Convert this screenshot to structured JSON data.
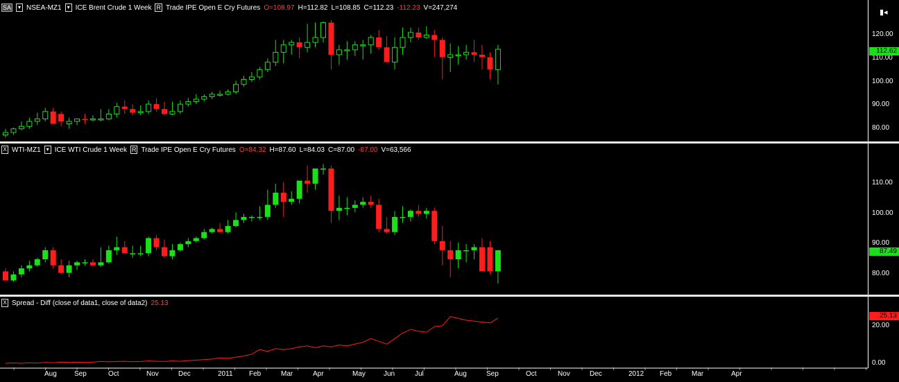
{
  "panels": [
    {
      "symbol_box": "SA",
      "symbol": "NSEA-MZ1",
      "desc": "ICE Brent Crude  1 Week",
      "rbox": "R",
      "info": "Trade  IPE  Open E Cry  Futures",
      "o_text": "O=108.97",
      "h_text": "H=112.82",
      "l_text": "L=108.85",
      "c_text": "C=112.23",
      "chg_text": "-112.23",
      "v_text": "V=247,274",
      "last_price": "112.62",
      "ticks": [
        "120.00",
        "110.00",
        "100.00",
        "90.00",
        "80.00"
      ]
    },
    {
      "symbol_box": "X",
      "symbol": "WTI-MZ1",
      "desc": "ICE WTI Crude  1 Week",
      "rbox": "R",
      "info": "Trade  IPE  Open E Cry  Futures",
      "o_text": "O=84.32",
      "h_text": "H=87.60",
      "l_text": "L=84.03",
      "c_text": "C=87.00",
      "chg_text": "-87.00",
      "v_text": "V=63,566",
      "last_price": "87.49",
      "ticks": [
        "110.00",
        "100.00",
        "90.00",
        "80.00"
      ]
    },
    {
      "symbol_box": "X",
      "title": "Spread - Diff  (close of data1,  close of data2)",
      "value_text": "25.13",
      "last_price": "25.13",
      "ticks": [
        "20.00",
        "0.00"
      ]
    }
  ],
  "x_axis_labels": [
    "Aug",
    "Sep",
    "Oct",
    "Nov",
    "Dec",
    "2011",
    "Feb",
    "Mar",
    "Apr",
    "May",
    "Jun",
    "Jul",
    "Aug",
    "Sep",
    "Oct",
    "Nov",
    "Dec",
    "2012",
    "Feb",
    "Mar",
    "Apr"
  ],
  "colors": {
    "up": "#19e019",
    "down": "#ff1c1c",
    "spread": "#ff1c1c",
    "background": "#000000"
  },
  "chart_data": [
    {
      "type": "candlestick",
      "name": "NSEA-MZ1",
      "ylim": [
        76,
        126
      ],
      "x": [
        "Jul",
        "Jul",
        "Aug",
        "Aug",
        "Aug",
        "Aug",
        "Aug",
        "Sep",
        "Sep",
        "Sep",
        "Sep",
        "Oct",
        "Oct",
        "Oct",
        "Oct",
        "Oct",
        "Nov",
        "Nov",
        "Nov",
        "Nov",
        "Dec",
        "Dec",
        "Dec",
        "Dec",
        "2011",
        "2011",
        "2011",
        "2011",
        "Feb",
        "Feb",
        "Feb",
        "Feb",
        "Mar",
        "Mar",
        "Mar",
        "Mar",
        "Mar",
        "Apr",
        "Apr",
        "Apr",
        "Apr",
        "May",
        "May",
        "May",
        "May",
        "Jun",
        "Jun",
        "Jun",
        "Jun",
        "Jun",
        "Jul",
        "Jul",
        "Jul",
        "Jul",
        "Aug",
        "Aug",
        "Aug",
        "Aug",
        "Sep",
        "Sep",
        "Sep",
        "Sep",
        "Oct"
      ],
      "open": [
        77.5,
        78.5,
        80.0,
        81.0,
        83.0,
        84.0,
        87.0,
        86.0,
        82.0,
        83.0,
        84.0,
        83.8,
        84.0,
        84.0,
        86.0,
        89.0,
        88.0,
        86.5,
        87.0,
        90.0,
        88.0,
        86.0,
        87.0,
        90.0,
        91.0,
        92.0,
        93.0,
        94.0,
        94.0,
        95.0,
        98.0,
        100.0,
        101.0,
        104.0,
        107.0,
        111.0,
        114.0,
        115.0,
        113.0,
        115.0,
        117.0,
        123.0,
        110.0,
        112.0,
        112.0,
        114.0,
        114.0,
        117.0,
        113.0,
        107.0,
        113.0,
        117.0,
        119.0,
        117.0,
        118.0,
        116.0,
        109.0,
        110.0,
        110.0,
        111.0,
        110.0,
        109.0,
        104.0
      ],
      "high": [
        80.0,
        80.5,
        83.0,
        84.5,
        86.5,
        88.5,
        88.5,
        87.0,
        84.5,
        84.0,
        86.0,
        85.5,
        88.0,
        88.0,
        90.5,
        91.5,
        90.0,
        89.5,
        91.5,
        92.5,
        91.0,
        91.0,
        91.5,
        92.5,
        94.0,
        94.0,
        95.0,
        95.5,
        96.0,
        99.5,
        101.5,
        103.0,
        105.0,
        108.5,
        116.0,
        116.0,
        116.0,
        117.0,
        122.5,
        123.0,
        123.5,
        124.0,
        114.0,
        115.5,
        115.5,
        116.0,
        118.0,
        120.0,
        117.5,
        117.0,
        121.0,
        121.0,
        121.0,
        121.5,
        120.0,
        117.0,
        114.5,
        113.5,
        114.0,
        116.0,
        114.0,
        111.0,
        114.0
      ],
      "low": [
        76.5,
        77.5,
        79.5,
        80.0,
        81.5,
        83.0,
        82.5,
        81.0,
        80.0,
        81.5,
        82.0,
        83.0,
        83.0,
        83.5,
        84.5,
        86.0,
        85.5,
        85.5,
        86.0,
        87.0,
        85.5,
        85.5,
        86.0,
        89.0,
        90.0,
        91.0,
        92.0,
        93.0,
        93.5,
        94.0,
        97.0,
        99.0,
        100.0,
        103.0,
        105.5,
        106.5,
        110.0,
        108.5,
        111.0,
        113.0,
        115.0,
        104.0,
        106.0,
        108.0,
        109.5,
        108.0,
        110.5,
        112.0,
        107.0,
        104.0,
        110.0,
        115.0,
        116.0,
        116.5,
        109.0,
        100.0,
        103.0,
        106.0,
        108.0,
        107.0,
        104.0,
        100.0,
        98.0
      ],
      "close": [
        78.5,
        80.0,
        81.0,
        83.0,
        84.0,
        87.0,
        82.0,
        83.0,
        83.0,
        84.0,
        83.8,
        84.0,
        84.0,
        86.0,
        89.0,
        88.0,
        86.5,
        87.0,
        90.0,
        88.0,
        86.0,
        87.0,
        90.0,
        91.0,
        92.0,
        93.0,
        94.0,
        94.0,
        95.0,
        98.0,
        100.0,
        101.0,
        104.0,
        107.0,
        111.0,
        114.0,
        115.0,
        113.0,
        115.0,
        117.0,
        123.0,
        110.0,
        112.0,
        112.0,
        114.0,
        114.0,
        117.0,
        113.0,
        107.0,
        113.0,
        117.0,
        119.0,
        117.0,
        118.0,
        116.0,
        109.0,
        110.0,
        110.0,
        111.0,
        110.0,
        109.0,
        104.0,
        112.23
      ]
    },
    {
      "type": "candlestick",
      "name": "WTI-MZ1",
      "ylim": [
        73,
        117
      ],
      "x": [
        "Jul",
        "Jul",
        "Aug",
        "Aug",
        "Aug",
        "Aug",
        "Aug",
        "Sep",
        "Sep",
        "Sep",
        "Sep",
        "Oct",
        "Oct",
        "Oct",
        "Oct",
        "Oct",
        "Nov",
        "Nov",
        "Nov",
        "Nov",
        "Dec",
        "Dec",
        "Dec",
        "Dec",
        "2011",
        "2011",
        "2011",
        "2011",
        "Feb",
        "Feb",
        "Feb",
        "Feb",
        "Mar",
        "Mar",
        "Mar",
        "Mar",
        "Mar",
        "Apr",
        "Apr",
        "Apr",
        "Apr",
        "May",
        "May",
        "May",
        "May",
        "Jun",
        "Jun",
        "Jun",
        "Jun",
        "Jun",
        "Jul",
        "Jul",
        "Jul",
        "Jul",
        "Aug",
        "Aug",
        "Aug",
        "Aug",
        "Sep",
        "Sep",
        "Sep",
        "Sep",
        "Oct"
      ],
      "open": [
        80.0,
        77.0,
        79.0,
        81.0,
        82.0,
        84.0,
        87.0,
        82.0,
        79.5,
        82.0,
        83.0,
        83.0,
        82.0,
        83.0,
        87.0,
        88.0,
        86.0,
        86.0,
        86.0,
        91.0,
        88.0,
        85.0,
        87.0,
        89.0,
        90.0,
        91.0,
        93.0,
        94.0,
        93.0,
        95.0,
        97.0,
        98.0,
        98.0,
        98.0,
        102.0,
        106.0,
        103.0,
        104.0,
        110.0,
        109.0,
        114.0,
        114.0,
        100.0,
        101.0,
        101.0,
        102.0,
        103.0,
        102.0,
        94.0,
        93.0,
        98.0,
        98.0,
        100.0,
        99.0,
        100.0,
        90.0,
        87.0,
        84.0,
        87.0,
        87.0,
        88.0,
        88.0,
        80.0
      ],
      "high": [
        81.0,
        80.0,
        82.0,
        83.5,
        84.5,
        88.0,
        88.0,
        84.0,
        83.5,
        83.5,
        84.0,
        84.0,
        88.0,
        88.5,
        91.5,
        90.0,
        88.5,
        88.5,
        91.5,
        92.0,
        90.5,
        89.0,
        89.5,
        91.0,
        91.5,
        94.0,
        94.5,
        96.0,
        97.0,
        99.5,
        99.0,
        98.5,
        101.5,
        107.0,
        109.0,
        109.5,
        106.5,
        108.0,
        115.0,
        114.0,
        115.5,
        115.0,
        105.0,
        104.5,
        103.5,
        104.5,
        105.0,
        104.0,
        98.0,
        100.0,
        101.5,
        100.5,
        102.0,
        101.0,
        101.0,
        95.0,
        90.0,
        89.5,
        89.0,
        89.0,
        91.0,
        90.0,
        84.0
      ],
      "low": [
        77.0,
        76.5,
        78.0,
        80.0,
        81.5,
        83.0,
        81.0,
        79.0,
        78.0,
        80.5,
        82.0,
        81.5,
        81.5,
        82.5,
        85.5,
        86.0,
        84.5,
        85.0,
        85.0,
        87.0,
        84.5,
        84.0,
        86.5,
        88.0,
        89.5,
        90.5,
        92.5,
        93.0,
        92.5,
        94.5,
        96.0,
        96.5,
        97.0,
        97.0,
        101.0,
        98.0,
        102.0,
        102.5,
        106.0,
        107.0,
        112.0,
        96.0,
        97.0,
        98.5,
        99.5,
        101.0,
        101.0,
        93.0,
        92.5,
        92.0,
        96.0,
        96.5,
        98.0,
        97.5,
        89.0,
        82.0,
        78.0,
        81.0,
        83.0,
        84.0,
        80.5,
        79.0,
        76.0
      ],
      "close": [
        77.0,
        79.0,
        81.0,
        82.0,
        84.0,
        87.0,
        82.0,
        79.5,
        82.0,
        83.0,
        83.0,
        82.0,
        83.0,
        87.0,
        88.0,
        86.0,
        86.0,
        86.0,
        91.0,
        88.0,
        85.0,
        87.0,
        89.0,
        90.0,
        91.0,
        93.0,
        94.0,
        93.0,
        95.0,
        97.0,
        98.0,
        98.0,
        98.0,
        102.0,
        106.0,
        103.0,
        104.0,
        110.0,
        109.0,
        114.0,
        114.0,
        100.0,
        101.0,
        101.0,
        102.0,
        103.0,
        102.0,
        94.0,
        93.0,
        98.0,
        98.0,
        100.0,
        99.0,
        100.0,
        90.0,
        87.0,
        84.0,
        87.0,
        87.0,
        88.0,
        80.0,
        80.0,
        87.0
      ]
    },
    {
      "type": "line",
      "name": "Spread - Diff",
      "ylim": [
        -1,
        30
      ],
      "x": [
        "Jul",
        "Jul",
        "Aug",
        "Aug",
        "Aug",
        "Aug",
        "Aug",
        "Sep",
        "Sep",
        "Sep",
        "Sep",
        "Oct",
        "Oct",
        "Oct",
        "Oct",
        "Oct",
        "Nov",
        "Nov",
        "Nov",
        "Nov",
        "Dec",
        "Dec",
        "Dec",
        "Dec",
        "2011",
        "2011",
        "2011",
        "2011",
        "Feb",
        "Feb",
        "Feb",
        "Feb",
        "Mar",
        "Mar",
        "Mar",
        "Mar",
        "Mar",
        "Apr",
        "Apr",
        "Apr",
        "Apr",
        "May",
        "May",
        "May",
        "May",
        "Jun",
        "Jun",
        "Jun",
        "Jun",
        "Jun",
        "Jul",
        "Jul",
        "Jul",
        "Jul",
        "Aug",
        "Aug",
        "Aug",
        "Aug",
        "Sep",
        "Sep",
        "Sep",
        "Sep",
        "Oct"
      ],
      "values": [
        0.5,
        0.7,
        0.5,
        0.8,
        0.6,
        1.0,
        0.8,
        1.2,
        1.0,
        1.2,
        1.0,
        1.2,
        1.5,
        1.3,
        1.5,
        1.6,
        1.4,
        1.5,
        1.8,
        1.6,
        1.5,
        1.8,
        1.6,
        2.0,
        2.2,
        2.5,
        2.8,
        3.5,
        3.2,
        3.8,
        4.5,
        5.5,
        8.0,
        7.0,
        8.5,
        8.0,
        8.5,
        9.5,
        10.0,
        9.0,
        10.0,
        9.5,
        10.5,
        10.0,
        11.0,
        12.0,
        14.0,
        12.5,
        11.0,
        14.0,
        17.0,
        19.0,
        18.0,
        17.5,
        20.5,
        21.0,
        26.0,
        25.0,
        24.0,
        23.5,
        23.0,
        22.5,
        25.13
      ]
    }
  ]
}
